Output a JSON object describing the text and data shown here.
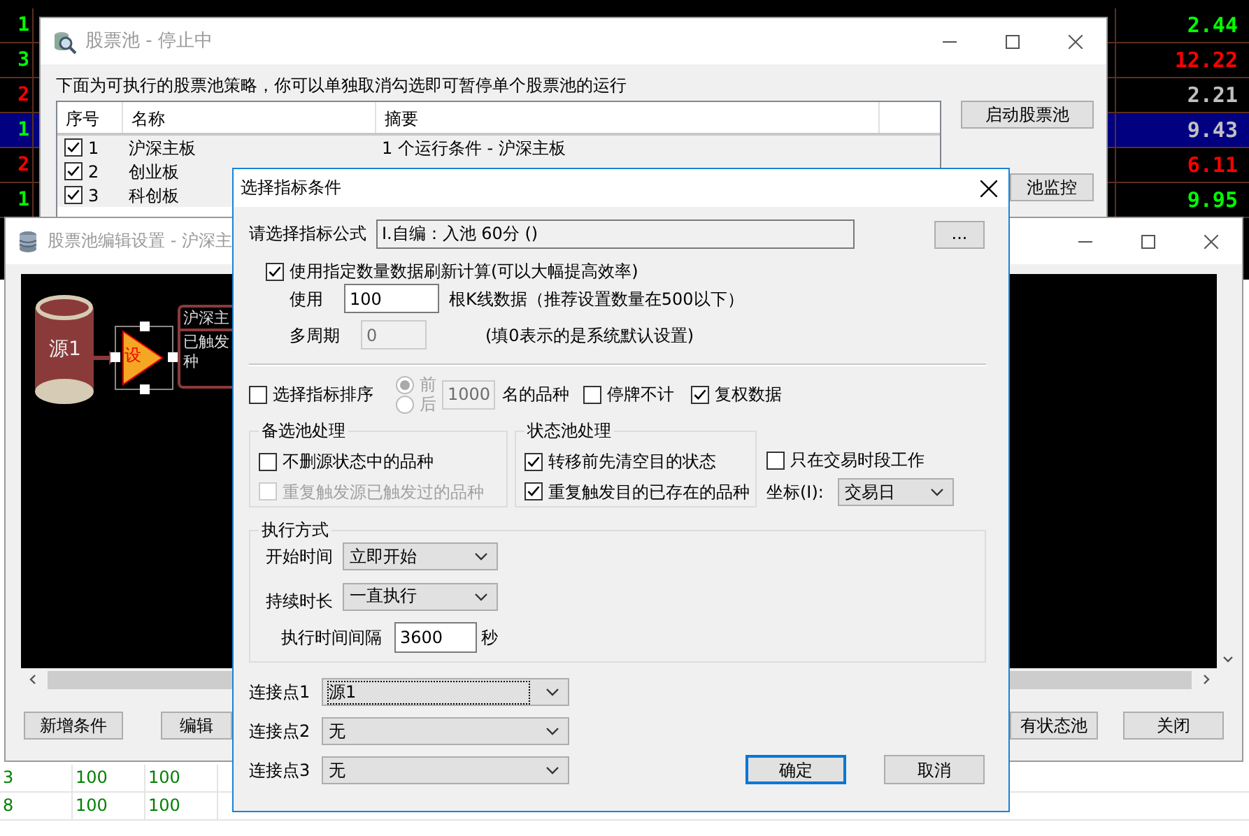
{
  "market_grid": {
    "rows": [
      {
        "selected": false,
        "cells": [
          {
            "text": "1",
            "color": "#00ff00"
          },
          {
            "text": "2.44",
            "color": "#00ff00"
          }
        ]
      },
      {
        "selected": false,
        "cells": [
          {
            "text": "3",
            "color": "#00ff00"
          },
          {
            "text": "12.22",
            "color": "#ff0000"
          }
        ]
      },
      {
        "selected": false,
        "cells": [
          {
            "text": "2",
            "color": "#ff0000"
          },
          {
            "text": "2.21",
            "color": "#c0c0c0"
          }
        ]
      },
      {
        "selected": true,
        "cells": [
          {
            "text": "1",
            "color": "#00ff00"
          },
          {
            "text": "9.43",
            "color": "#c0c0c0"
          }
        ]
      },
      {
        "selected": false,
        "cells": [
          {
            "text": "2",
            "color": "#ff0000"
          },
          {
            "text": "6.11",
            "color": "#ff0000"
          }
        ]
      },
      {
        "selected": false,
        "cells": [
          {
            "text": "1",
            "color": "#00ff00"
          },
          {
            "text": "9.95",
            "color": "#00ff00"
          }
        ]
      }
    ]
  },
  "pool_window": {
    "title": "股票池  -  停止中",
    "description": "下面为可执行的股票池策略，你可以单独取消勾选即可暂停单个股票池的运行",
    "table": {
      "columns": [
        "序号",
        "名称",
        "摘要"
      ],
      "rows": [
        {
          "checked": true,
          "index": "1",
          "name": "沪深主板",
          "summary": "1 个运行条件 - 沪深主板"
        },
        {
          "checked": true,
          "index": "2",
          "name": "创业板"
        },
        {
          "checked": true,
          "index": "3",
          "name": "科创板"
        }
      ]
    },
    "buttons": [
      "启动股票池",
      "池监控"
    ]
  },
  "edit_window": {
    "title": "股票池编辑设置 - 沪深主",
    "diagram": {
      "source": "源1",
      "setter": "设",
      "node_lines": [
        "沪深主",
        "已触发",
        "种"
      ]
    },
    "buttons": [
      "新增条件",
      "编辑",
      "有状态池",
      "关闭"
    ]
  },
  "dialog": {
    "title": "选择指标条件",
    "formula": {
      "label": "请选择指标公式",
      "value": "I.自编：入池 60分 ()",
      "browse": "..."
    },
    "use_count": {
      "checked": true,
      "label": "使用指定数量数据刷新计算(可以大幅提高效率)"
    },
    "bars": {
      "label": "使用",
      "value": "100",
      "note": "根K线数据（推荐设置数量在500以下）"
    },
    "multi_period": {
      "label": "多周期",
      "value": "0",
      "disabled": true,
      "note": "(填0表示的是系统默认设置)"
    },
    "sort": {
      "checked": false,
      "label": "选择指标排序",
      "radios": [
        {
          "label": "前",
          "selected": true
        },
        {
          "label": "后",
          "selected": false
        }
      ],
      "count": "1000",
      "suffix": "名的品种"
    },
    "options": [
      {
        "label": "停牌不计",
        "checked": false
      },
      {
        "label": "复权数据",
        "checked": true
      }
    ],
    "candidate_group": {
      "title": "备选池处理",
      "items": [
        {
          "label": "不删源状态中的品种",
          "checked": false,
          "disabled": false
        },
        {
          "label": "重复触发源已触发过的品种",
          "checked": false,
          "disabled": true
        }
      ]
    },
    "state_group": {
      "title": "状态池处理",
      "items": [
        {
          "label": "转移前先清空目的状态",
          "checked": true,
          "disabled": false
        },
        {
          "label": "重复触发目的已存在的品种",
          "checked": true,
          "disabled": false
        }
      ]
    },
    "trading_hours": {
      "label": "只在交易时段工作",
      "checked": false
    },
    "axis": {
      "label": "坐标(I):",
      "value": "交易日"
    },
    "execution": {
      "title": "执行方式",
      "start": {
        "label": "开始时间",
        "value": "立即开始"
      },
      "duration": {
        "label": "持续时长",
        "value": "一直执行"
      },
      "interval": {
        "label": "执行时间间隔",
        "value": "3600",
        "unit": "秒"
      }
    },
    "connections": [
      {
        "label": "连接点1",
        "value": "源1",
        "focused": true
      },
      {
        "label": "连接点2",
        "value": "无",
        "focused": false
      },
      {
        "label": "连接点3",
        "value": "无",
        "focused": false
      }
    ],
    "buttons": [
      {
        "label": "确定",
        "default": true
      },
      {
        "label": "取消",
        "default": false
      }
    ]
  },
  "bottom_table": {
    "rows": [
      [
        "3",
        "100",
        "100"
      ],
      [
        "8",
        "100",
        "100"
      ]
    ]
  }
}
